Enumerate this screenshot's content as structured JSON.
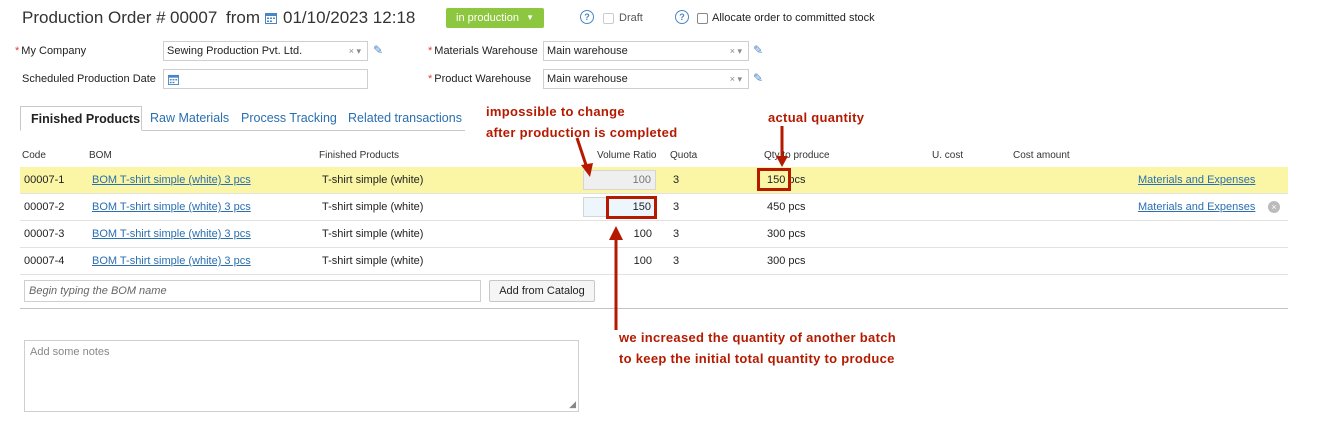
{
  "header": {
    "title_prefix": "Production Order #",
    "order_number": "00007",
    "from_label": "from",
    "datetime": "01/10/2023 12:18",
    "status": "in production",
    "draft_label": "Draft",
    "allocate_label": "Allocate order to committed stock",
    "help_glyph": "?"
  },
  "form": {
    "company_label": "My Company",
    "company_value": "Sewing Production Pvt. Ltd.",
    "scheduled_label": "Scheduled Production Date",
    "materials_wh_label": "Materials Warehouse",
    "materials_wh_value": "Main warehouse",
    "product_wh_label": "Product Warehouse",
    "product_wh_value": "Main warehouse",
    "required_mark": "*",
    "clear_glyph": "× ▾",
    "pencil_glyph": "✎"
  },
  "tabs": [
    {
      "label": "Finished Products",
      "active": true
    },
    {
      "label": "Raw Materials",
      "active": false
    },
    {
      "label": "Process Tracking",
      "active": false
    },
    {
      "label": "Related transactions",
      "active": false
    }
  ],
  "table": {
    "columns": [
      "Code",
      "BOM",
      "Finished Products",
      "Volume Ratio",
      "Quota",
      "Qty to produce",
      "U. cost",
      "Cost amount"
    ],
    "rows": [
      {
        "code": "00007-1",
        "bom": "BOM T-shirt simple (white) 3 pcs",
        "product": "T-shirt simple (white)",
        "ratio": "100",
        "quota": "3",
        "qty": "150 pcs",
        "link": "Materials and Expenses"
      },
      {
        "code": "00007-2",
        "bom": "BOM T-shirt simple (white) 3 pcs",
        "product": "T-shirt simple (white)",
        "ratio": "150",
        "quota": "3",
        "qty": "450 pcs",
        "link": "Materials and Expenses"
      },
      {
        "code": "00007-3",
        "bom": "BOM T-shirt simple (white) 3 pcs",
        "product": "T-shirt simple (white)",
        "ratio": "100",
        "quota": "3",
        "qty": "300 pcs",
        "link": ""
      },
      {
        "code": "00007-4",
        "bom": "BOM T-shirt simple (white) 3 pcs",
        "product": "T-shirt simple (white)",
        "ratio": "100",
        "quota": "3",
        "qty": "300 pcs",
        "link": ""
      }
    ]
  },
  "bom_input_placeholder": "Begin typing the BOM name",
  "add_from_catalog": "Add from Catalog",
  "notes_placeholder": "Add some notes",
  "annotations": {
    "impossible_1": "impossible to change",
    "impossible_2": "after production is completed",
    "actual_qty": "actual quantity",
    "increased_1": "we increased the quantity of another batch",
    "increased_2": "to keep the initial total quantity to produce"
  },
  "colors": {
    "accent_green": "#8dc63f",
    "link_blue": "#2a6fb0",
    "highlight_row": "#fbf6a6",
    "annotation_red": "#b51a00"
  }
}
